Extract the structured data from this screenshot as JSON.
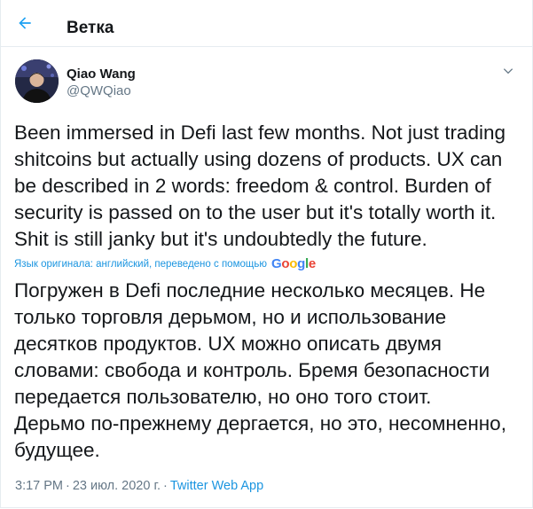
{
  "header": {
    "title": "Ветка",
    "back_icon": "arrow-left-icon",
    "accent_color": "#1da1f2"
  },
  "tweet": {
    "author_name": "Qiao Wang",
    "author_handle": "@QWQiao",
    "caret_icon": "chevron-down-icon",
    "text": "Been immersed in Defi last few months. Not just trading\nshitcoins but actually using dozens of products. UX can\nbe described in 2 words: freedom & control. Burden of\nsecurity is passed on to the user but it's totally worth it.\nShit is still janky but it's undoubtedly the future.",
    "translation_note": "Язык оригинала: английский, переведено с помощью",
    "translation_provider": "Google",
    "translated_text": "Погружен в Defi последние несколько месяцев. Не\nтолько торговля дерьмом, но и использование\nдесятков продуктов. UX можно описать двумя\nсловами: свобода и контроль. Бремя безопасности\nпередается пользователю, но оно того стоит.\nДерьмо по-прежнему дергается, но это, несомненно,\nбудущее.",
    "time": "3:17 PM",
    "separator": "·",
    "date": "23 июл. 2020 г.",
    "source": "Twitter Web App"
  },
  "colors": {
    "text_primary": "#14171a",
    "text_secondary": "#657786",
    "link": "#1b95e0",
    "divider": "#e6ecf0"
  }
}
